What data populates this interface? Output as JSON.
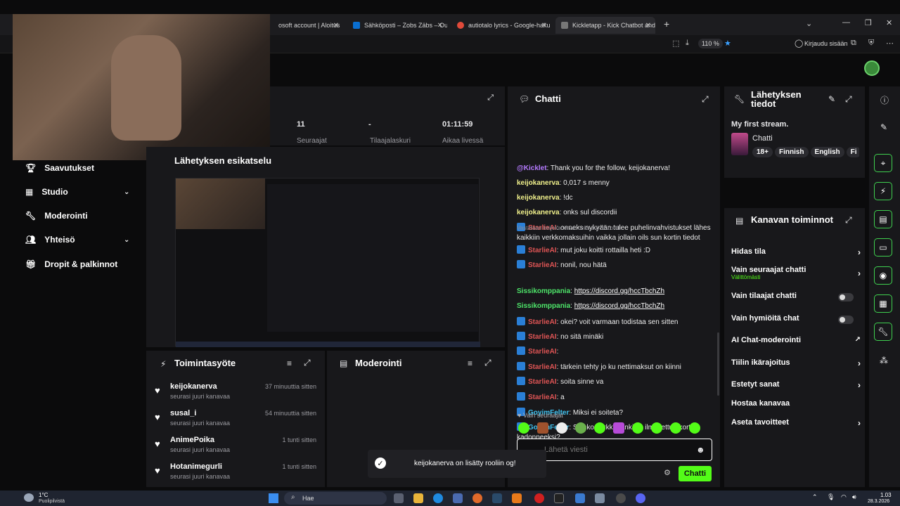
{
  "browser": {
    "tabs": [
      {
        "label": "osoft account | Aloitus",
        "color": "#1f5fc4"
      },
      {
        "label": "Sähköposti – Zobs Zäbs – Outlo",
        "color": "#0a6fd1"
      },
      {
        "label": "autiotalo lyrics - Google-haku",
        "color": "#e04a3a"
      },
      {
        "label": "Kickletapp - Kick Chatbot and C",
        "color": "#777777"
      }
    ],
    "zoom": "110 %",
    "signin": "Kirjaudu sisään"
  },
  "sidebar": {
    "items": [
      {
        "label": "Saavutukset",
        "icon": "trophy-icon",
        "has_chevron": false
      },
      {
        "label": "Studio",
        "icon": "studio-icon",
        "has_chevron": true
      },
      {
        "label": "Moderointi",
        "icon": "wrench-icon",
        "has_chevron": false
      },
      {
        "label": "Yhteisö",
        "icon": "people-icon",
        "has_chevron": true
      },
      {
        "label": "Dropit & palkinnot",
        "icon": "gift-icon",
        "has_chevron": false
      }
    ]
  },
  "stats": {
    "followers": {
      "value": "11",
      "label": "Seuraajat"
    },
    "subs": {
      "value": "-",
      "label": "Tilaajalaskuri"
    },
    "live": {
      "value": "01:11:59",
      "label": "Aikaa livessä"
    }
  },
  "preview_title": "Lähetyksen esikatselu",
  "activity": {
    "title": "Toimintasyöte",
    "items": [
      {
        "name": "keijokanerva",
        "sub": "seurasi juuri kanavaa",
        "time": "37 minuuttia sitten"
      },
      {
        "name": "susal_i",
        "sub": "seurasi juuri kanavaa",
        "time": "54 minuuttia sitten"
      },
      {
        "name": "AnimePoika",
        "sub": "seurasi juuri kanavaa",
        "time": "1 tunti sitten"
      },
      {
        "name": "Hotanimegurli",
        "sub": "seurasi juuri kanavaa",
        "time": "1 tunti sitten"
      }
    ]
  },
  "moderation": {
    "title": "Moderointi"
  },
  "chat": {
    "title": "Chatti",
    "messages": [
      {
        "user": "@Kicklet",
        "cls": "u-kick",
        "bot": false,
        "text": ": Thank you for the follow, keijokanerva!"
      },
      {
        "user": "keijokanerva",
        "cls": "u-k",
        "bot": false,
        "text": ": 0,017 s menny"
      },
      {
        "user": "keijokanerva",
        "cls": "u-k",
        "bot": false,
        "text": ": !dc"
      },
      {
        "user": "keijokanerva",
        "cls": "u-k",
        "bot": false,
        "text": ": onks sul discordii"
      },
      {
        "user": "StarlieAI",
        "cls": "u-s",
        "bot": true,
        "text": ": onneks nykyään tulee puhelinvahvistukset lähes kaikkiin verkkomaksuihin vaikka jollain oils sun kortin tiedot"
      },
      {
        "user": "StarlieAI",
        "cls": "u-s",
        "bot": true,
        "text": ": mut joku koitti rottailla heti :D"
      },
      {
        "user": "StarlieAI",
        "cls": "u-s",
        "bot": true,
        "text": ": nonil, nou hätä"
      },
      {
        "user": "Sissikomppania",
        "cls": "u-p",
        "bot": false,
        "text": ": ",
        "link": "https://discord.gg/hccTbchZh"
      },
      {
        "user": "Sissikomppania",
        "cls": "u-p",
        "bot": false,
        "text": ": ",
        "link": "https://discord.gg/hccTbchZh"
      },
      {
        "user": "StarlieAI",
        "cls": "u-s",
        "bot": true,
        "text": ": okei? voit varmaan todistaa sen sitten"
      },
      {
        "user": "StarlieAI",
        "cls": "u-s",
        "bot": true,
        "text": ": no sitä minäki"
      },
      {
        "user": "StarlieAI",
        "cls": "u-s",
        "bot": true,
        "text": ": "
      },
      {
        "user": "StarlieAI",
        "cls": "u-s",
        "bot": true,
        "text": ": tärkein tehty jo ku nettimaksut on kiinni"
      },
      {
        "user": "StarlieAI",
        "cls": "u-s",
        "bot": true,
        "text": ": soita sinne va"
      },
      {
        "user": "StarlieAI",
        "cls": "u-s",
        "bot": true,
        "text": ": a"
      },
      {
        "user": "GoyimFelter",
        "cls": "u-g",
        "bot": true,
        "text": ": Miksi ei soiteta?"
      },
      {
        "user": "GoyimFelter",
        "cls": "u-g",
        "bot": true,
        "text": ": Saisko verkkopankista ilmoitettua kortin kadonneeksi?"
      },
      {
        "user": "StarlieAI",
        "cls": "u-s",
        "bot": true,
        "text": ": "
      }
    ],
    "reply_note": "Vastataan keijokanerva: onks sul discordii",
    "followers_only": "Vain seuraajat",
    "input_placeholder": "Lähetä viesti",
    "send_label": "Chatti"
  },
  "stream_info": {
    "title": "Lähetyksen tiedot",
    "stream_name": "My first stream.",
    "category": "Chatti",
    "tags": [
      "18+",
      "Finnish",
      "English",
      "Fi"
    ]
  },
  "channel_actions": {
    "title": "Kanavan toiminnot",
    "rows": [
      {
        "label": "Hidas tila",
        "control": "arrow"
      },
      {
        "label": "Vain seuraajat chatti",
        "sub": "Välittömästi",
        "control": "arrow"
      },
      {
        "label": "Vain tilaajat chatti",
        "control": "toggle"
      },
      {
        "label": "Vain hymiöitä chat",
        "control": "toggle"
      },
      {
        "label": "AI Chat-moderointi",
        "control": "external"
      },
      {
        "label": "Tiilin ikärajoitus",
        "control": "arrow"
      },
      {
        "label": "Estetyt sanat",
        "control": "arrow"
      },
      {
        "label": "Hostaa kanavaa",
        "control": "none"
      },
      {
        "label": "Aseta tavoitteet",
        "control": "arrow"
      }
    ]
  },
  "toast": {
    "text": "keijokanerva on lisätty rooliin og!"
  },
  "taskbar": {
    "weather_temp": "1°C",
    "weather_desc": "Puolipilvistä",
    "search": "Hae",
    "time": "1.03",
    "date": "28.3.2026"
  },
  "colors": {
    "accent": "#53fc18",
    "panel": "#18181b",
    "bg": "#0b0b0c"
  }
}
